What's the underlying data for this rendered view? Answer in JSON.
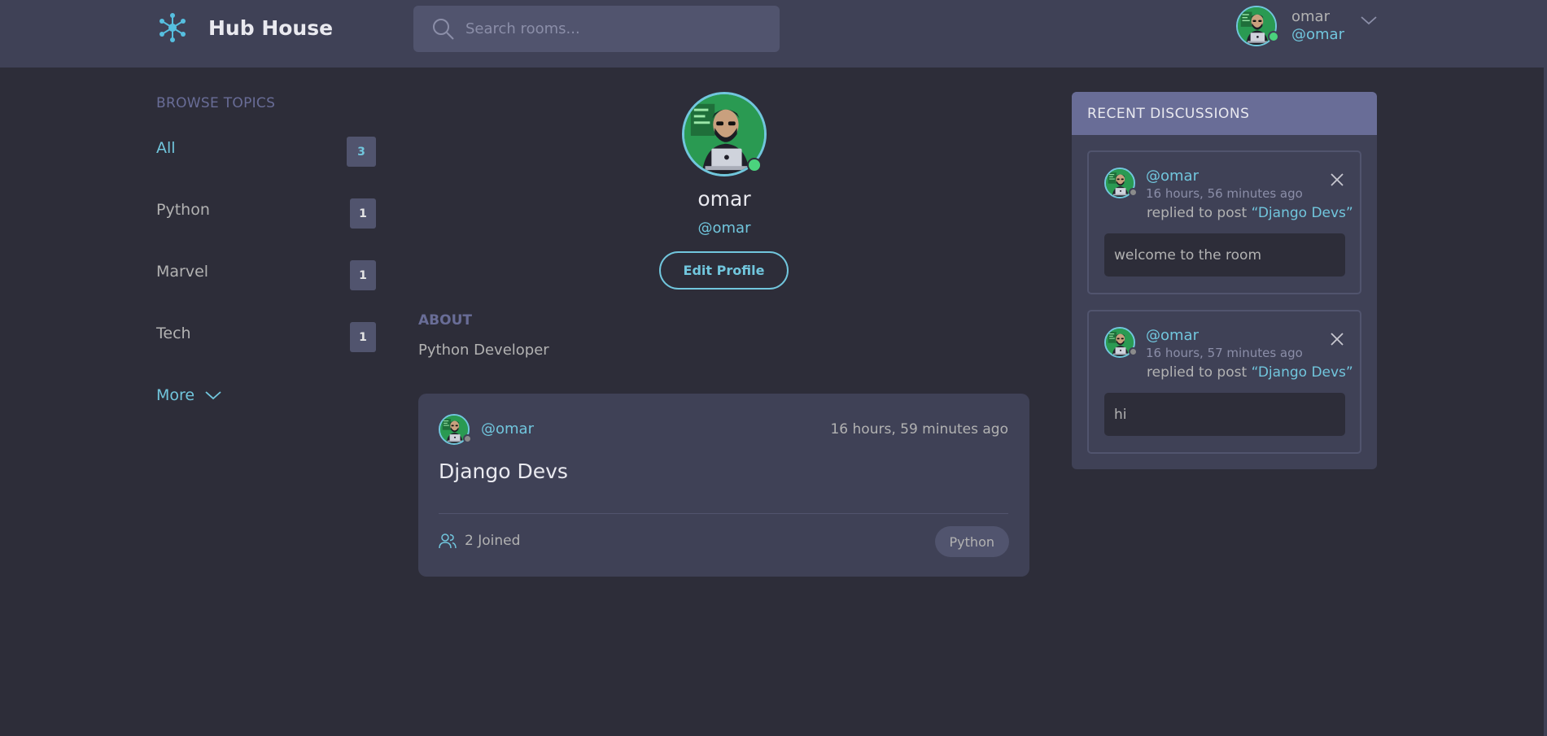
{
  "header": {
    "brand": "Hub House",
    "search_placeholder": "Search rooms...",
    "user_name": "omar",
    "user_handle": "@omar"
  },
  "sidebar": {
    "title": "BROWSE TOPICS",
    "topics": [
      {
        "label": "All",
        "count": "3"
      },
      {
        "label": "Python",
        "count": "1"
      },
      {
        "label": "Marvel",
        "count": "1"
      },
      {
        "label": "Tech",
        "count": "1"
      }
    ],
    "more_label": "More"
  },
  "profile": {
    "name": "omar",
    "handle": "@omar",
    "edit_label": "Edit Profile",
    "about_title": "ABOUT",
    "about_text": "Python Developer"
  },
  "rooms": [
    {
      "host_handle": "@omar",
      "time": "16 hours, 59 minutes ago",
      "title": "Django Devs",
      "joined": "2 Joined",
      "topic": "Python"
    }
  ],
  "recent": {
    "title": "RECENT DISCUSSIONS",
    "items": [
      {
        "handle": "@omar",
        "time": "16 hours, 56 minutes ago",
        "action": "replied to post",
        "post": "“Django Devs”",
        "message": "welcome to the room"
      },
      {
        "handle": "@omar",
        "time": "16 hours, 57 minutes ago",
        "action": "replied to post",
        "post": "“Django Devs”",
        "message": "hi"
      }
    ]
  },
  "colors": {
    "background": "#2d2d39",
    "surface": "#3f4156",
    "accent": "#71c6dd",
    "muted_heading": "#696d97",
    "online": "#4bd37d"
  },
  "icons": [
    "hub-logo-icon",
    "search-icon",
    "chevron-down-icon",
    "users-icon",
    "close-icon",
    "online-status-icon",
    "offline-status-icon"
  ]
}
